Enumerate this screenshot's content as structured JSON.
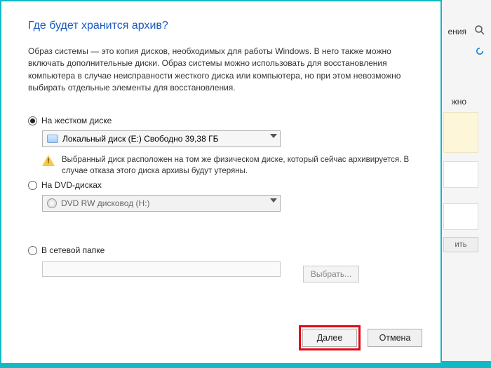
{
  "bg": {
    "word_fragment1": "ения",
    "word_fragment2": "жно",
    "button_fragment": "ить"
  },
  "dialog": {
    "title": "Где будет хранится архив?",
    "description": "Образ системы — это копия дисков, необходимых для работы Windows. В него также можно включать дополнительные диски. Образ системы можно использовать для восстановления компьютера в случае неисправности жесткого диска или компьютера, но при этом невозможно выбирать отдельные элементы для восстановления.",
    "opt_hdd": {
      "label": "На жестком диске",
      "combo": "Локальный диск (E:)  Свободно 39,38 ГБ",
      "warning": "Выбранный диск расположен на том же физическом диске, который сейчас архивируется. В случае отказа этого диска архивы будут утеряны."
    },
    "opt_dvd": {
      "label": "На DVD-дисках",
      "combo": "DVD RW дисковод (H:)"
    },
    "opt_net": {
      "label": "В сетевой папке",
      "browse": "Выбрать..."
    },
    "buttons": {
      "next": "Далее",
      "cancel": "Отмена"
    }
  }
}
